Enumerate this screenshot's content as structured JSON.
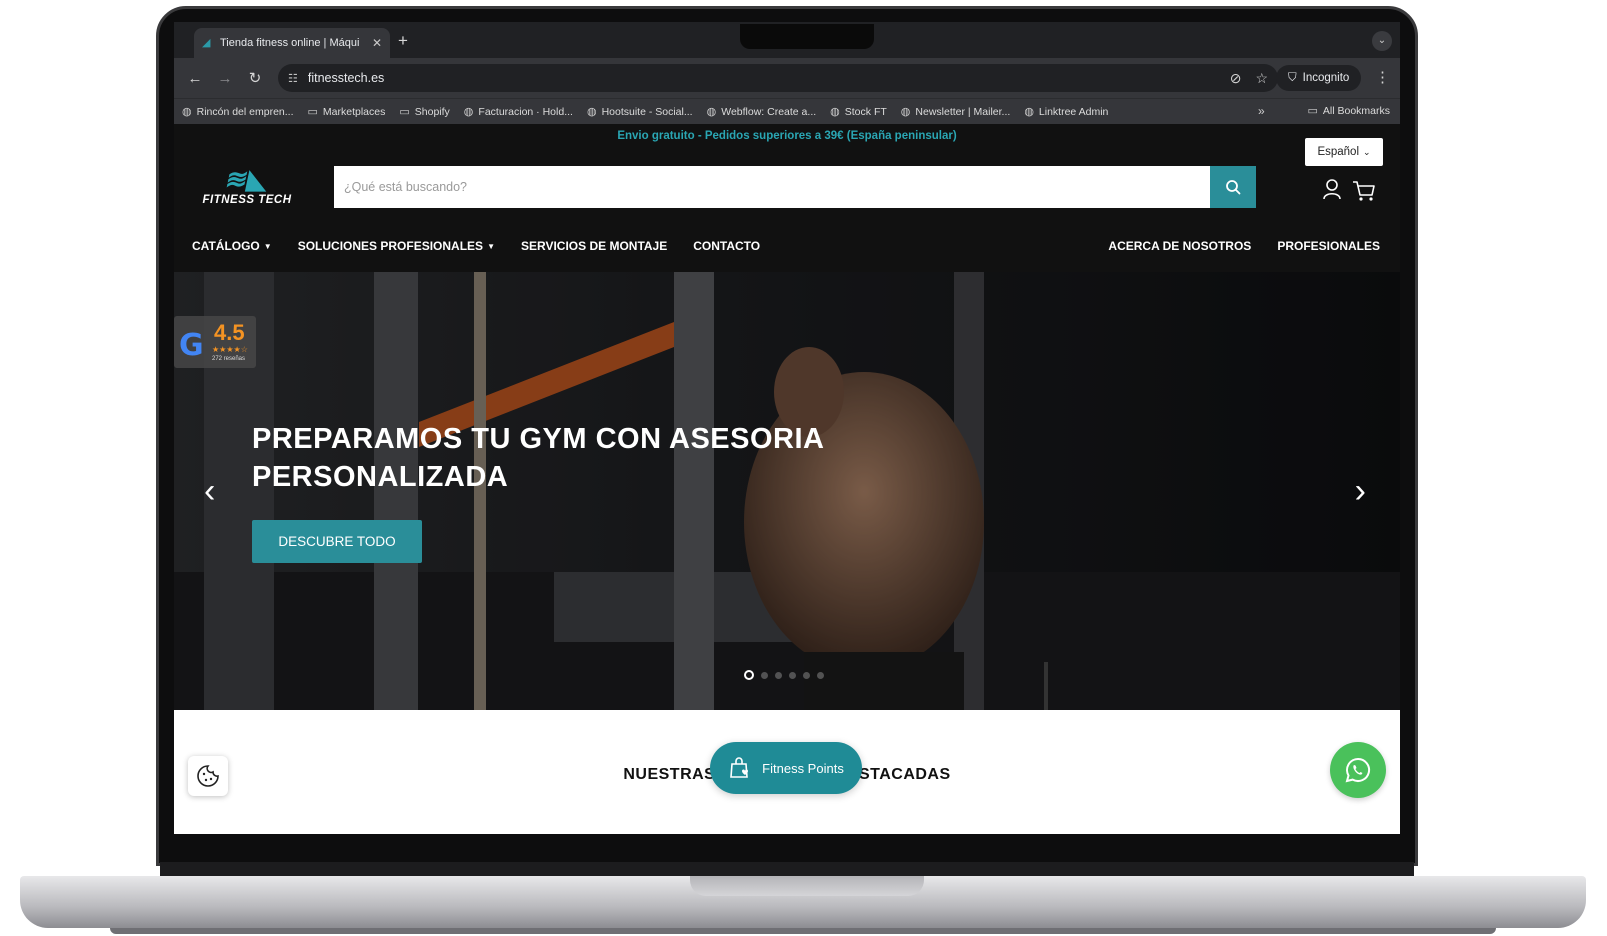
{
  "browser": {
    "tab_title": "Tienda fitness online | Máqui",
    "url": "fitnesstech.es",
    "incognito_label": "Incognito",
    "bookmarks": [
      {
        "label": "Rincón del empren...",
        "icon": "globe-icon"
      },
      {
        "label": "Marketplaces",
        "icon": "folder-icon"
      },
      {
        "label": "Shopify",
        "icon": "folder-icon"
      },
      {
        "label": "Facturacion · Hold...",
        "icon": "globe-icon"
      },
      {
        "label": "Hootsuite - Social...",
        "icon": "globe-icon"
      },
      {
        "label": "Webflow: Create a...",
        "icon": "globe-icon"
      },
      {
        "label": "Stock FT",
        "icon": "globe-icon"
      },
      {
        "label": "Newsletter | Mailer...",
        "icon": "globe-icon"
      },
      {
        "label": "Linktree Admin",
        "icon": "globe-icon"
      }
    ],
    "all_bookmarks_label": "All Bookmarks"
  },
  "site": {
    "announcement": "Envio gratuito - Pedidos superiores a 39€ (España peninsular)",
    "language": "Español",
    "logo_text": "FITNESS TECH",
    "search_placeholder": "¿Qué está buscando?",
    "nav": {
      "left": [
        {
          "label": "CATÁLOGO",
          "dropdown": true
        },
        {
          "label": "SOLUCIONES PROFESIONALES",
          "dropdown": true
        },
        {
          "label": "SERVICIOS DE MONTAJE",
          "dropdown": false
        },
        {
          "label": "CONTACTO",
          "dropdown": false
        }
      ],
      "right": [
        {
          "label": "ACERCA DE NOSOTROS"
        },
        {
          "label": "PROFESIONALES"
        }
      ]
    },
    "hero": {
      "title": "PREPARAMOS TU GYM CON ASESORIA PERSONALIZADA",
      "cta": "DESCUBRE TODO",
      "slides_count": 6,
      "active_slide": 1
    },
    "rating": {
      "value": "4.5",
      "stars": "★★★★☆",
      "count": "272 reseñas"
    },
    "section_title": "NUESTRAS CATEGORÍAS DESTACADAS",
    "points_button": "Fitness Points"
  },
  "colors": {
    "accent": "#2a8e99",
    "announcement": "#2aa6b3",
    "rating": "#f49323",
    "whatsapp": "#4ac15b"
  }
}
